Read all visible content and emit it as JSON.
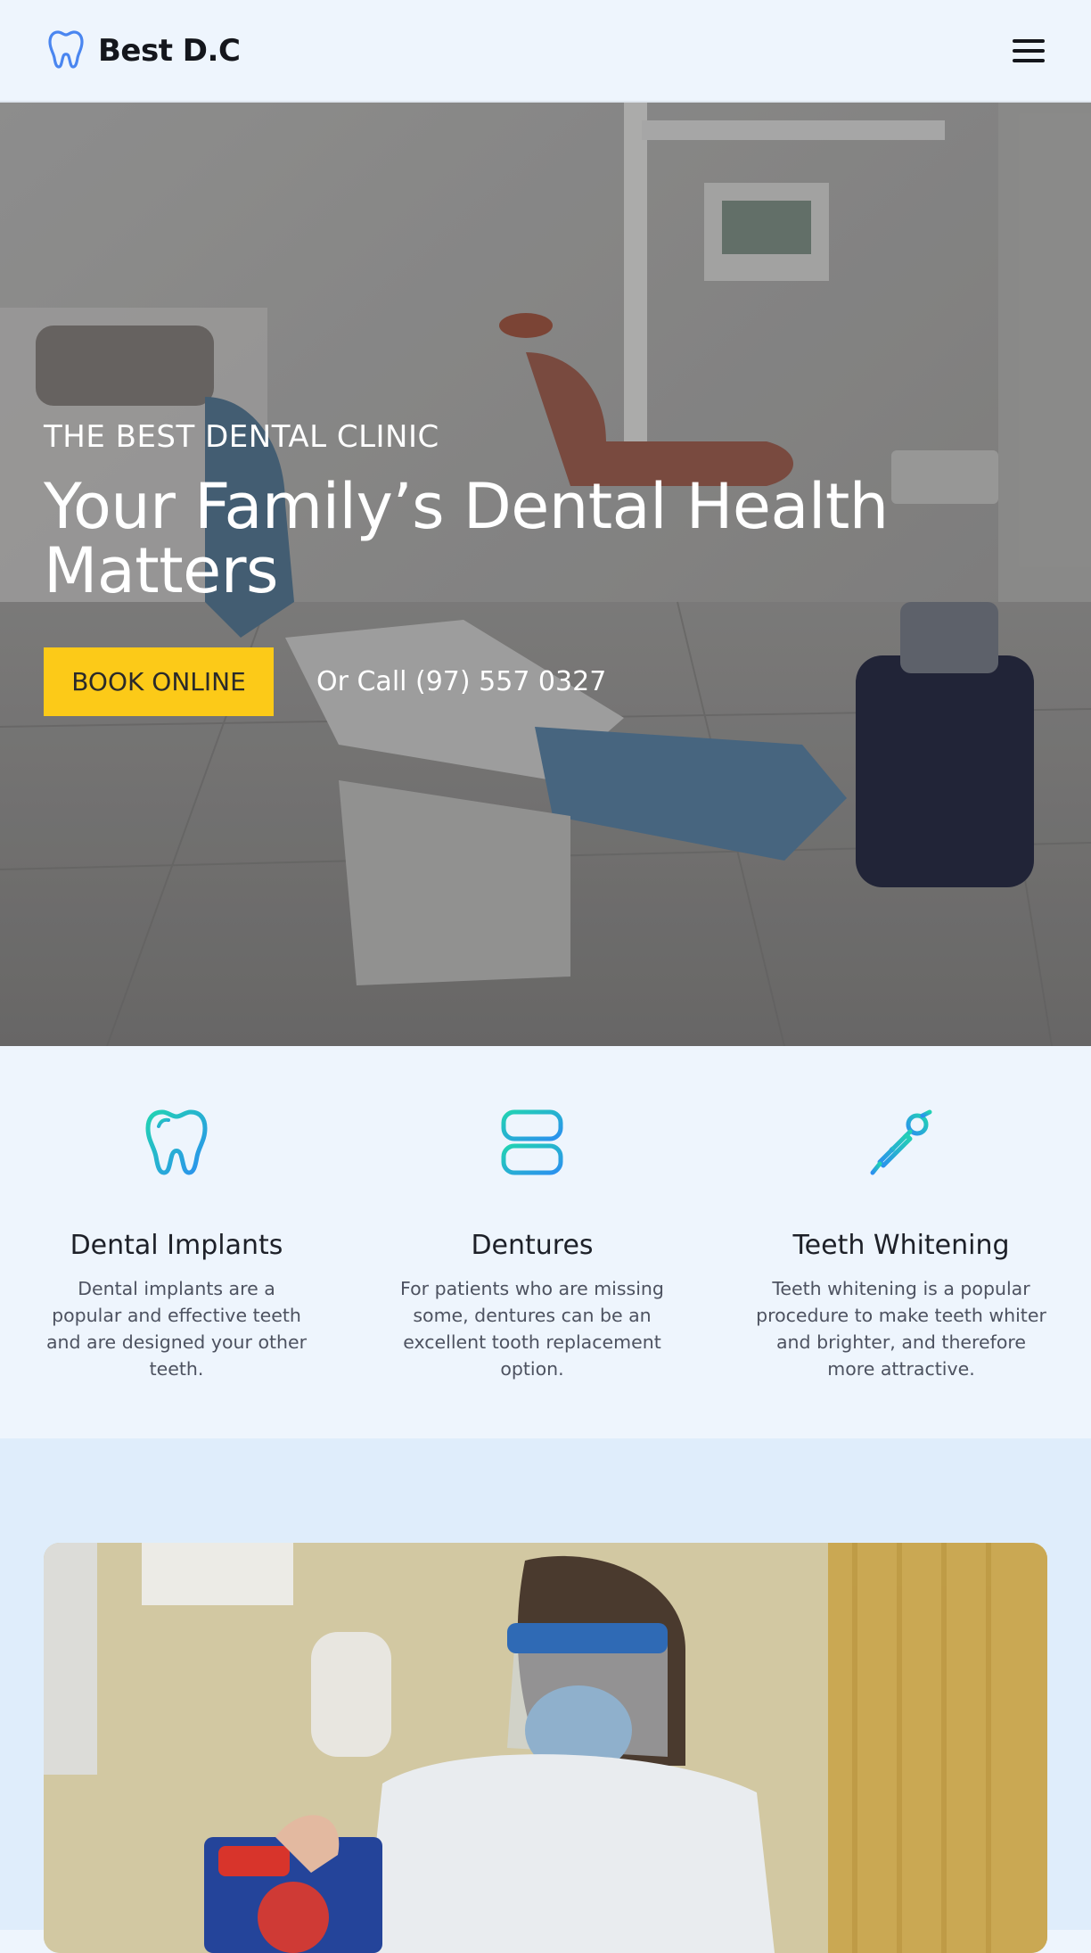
{
  "header": {
    "brand": "Best D.C",
    "logo_icon": "tooth-icon",
    "menu_icon": "hamburger-menu-icon"
  },
  "hero": {
    "eyebrow": "THE BEST DENTAL CLINIC",
    "title": "Your Family’s Dental Health Matters",
    "book_button": "BOOK ONLINE",
    "call_text": "Or Call (97) 557 0327",
    "background_image": "dental-chair-clinic-room"
  },
  "services": [
    {
      "icon": "tooth-icon",
      "title": "Dental Implants",
      "description": "Dental implants are a popular and effective teeth and are designed your other teeth."
    },
    {
      "icon": "dentures-icon",
      "title": "Dentures",
      "description": "For patients who are missing some, dentures can be an excellent tooth replacement option."
    },
    {
      "icon": "dental-mirror-icon",
      "title": "Teeth Whitening",
      "description": "Teeth whitening is a popular procedure to make teeth whiter and brighter, and therefore more attractive."
    }
  ],
  "lower": {
    "photo": "dentist-with-face-shield-holding-toothbrush-box"
  },
  "colors": {
    "accent_yellow": "#fcca18",
    "page_bg": "#eef5fd",
    "section_bg": "#dfedfb",
    "icon_gradient_start": "#22d3b2",
    "icon_gradient_end": "#2b8ff0",
    "logo_blue": "#4a86f0"
  }
}
